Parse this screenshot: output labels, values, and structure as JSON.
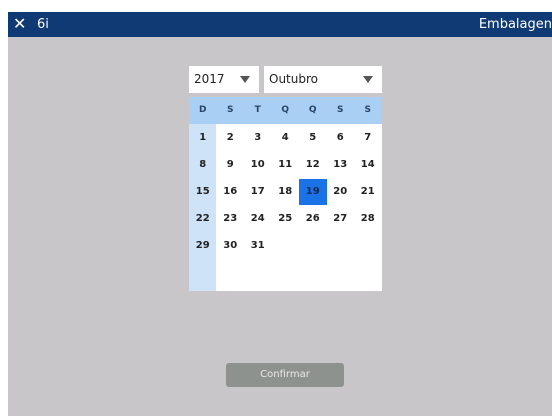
{
  "titlebar": {
    "close_icon": "✕",
    "title": "6i",
    "right_text": "Embalagen"
  },
  "date_picker": {
    "year": "2017",
    "month": "Outubro",
    "weekdays": [
      "D",
      "S",
      "T",
      "Q",
      "Q",
      "S",
      "S"
    ],
    "selected_day": "19",
    "weeks": [
      [
        "1",
        "2",
        "3",
        "4",
        "5",
        "6",
        "7"
      ],
      [
        "8",
        "9",
        "10",
        "11",
        "12",
        "13",
        "14"
      ],
      [
        "15",
        "16",
        "17",
        "18",
        "19",
        "20",
        "21"
      ],
      [
        "22",
        "23",
        "24",
        "25",
        "26",
        "27",
        "28"
      ],
      [
        "29",
        "30",
        "31"
      ]
    ]
  },
  "footer": {
    "confirm_label": "Confirmar"
  },
  "colors": {
    "titlebar": "#0f3a73",
    "background": "#c9c6c9",
    "header": "#a9d0f4",
    "sunday_column": "#cfe3f8",
    "selected": "#1a73e6",
    "button": "#8e928e"
  }
}
